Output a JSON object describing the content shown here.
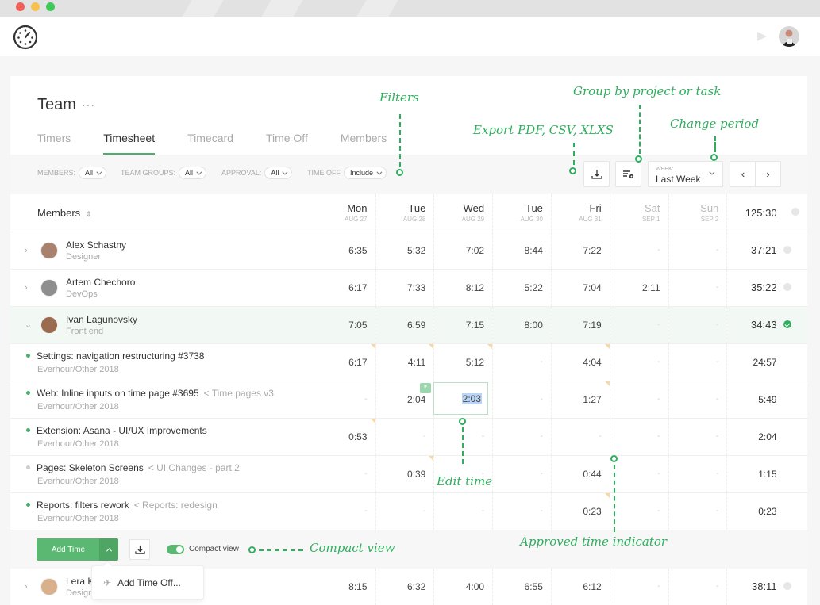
{
  "window": {
    "traffic_lights": {
      "close": "#f25f58",
      "minimize": "#f8c14c",
      "maximize": "#3ec956"
    }
  },
  "appbar": {
    "logo_icon": "stopwatch-dots-icon",
    "notification_icon": "bell-icon",
    "user_avatar": "user-avatar"
  },
  "page": {
    "title": "Team",
    "more_label": "···",
    "tabs": [
      {
        "label": "Timers",
        "active": false
      },
      {
        "label": "Timesheet",
        "active": true
      },
      {
        "label": "Timecard",
        "active": false
      },
      {
        "label": "Time Off",
        "active": false
      },
      {
        "label": "Members",
        "active": false
      }
    ]
  },
  "filters": [
    {
      "label": "MEMBERS:",
      "value": "All"
    },
    {
      "label": "TEAM GROUPS:",
      "value": "All"
    },
    {
      "label": "APPROVAL:",
      "value": "All"
    },
    {
      "label": "TIME OFF",
      "value": "Include"
    }
  ],
  "toolbar": {
    "export_icon": "download-icon",
    "group_icon": "list-settings-icon",
    "week_label": "WEEK:",
    "week_value": "Last Week",
    "prev_icon": "chevron-left-icon",
    "next_icon": "chevron-right-icon"
  },
  "table": {
    "members_header": "Members",
    "sort_icon": "sort-icon",
    "grand_total": "125:30",
    "days": [
      {
        "name": "Mon",
        "date": "AUG 27",
        "weekend": false
      },
      {
        "name": "Tue",
        "date": "AUG 28",
        "weekend": false
      },
      {
        "name": "Wed",
        "date": "AUG 29",
        "weekend": false
      },
      {
        "name": "Tue",
        "date": "AUG 30",
        "weekend": false
      },
      {
        "name": "Fri",
        "date": "AUG 31",
        "weekend": false
      },
      {
        "name": "Sat",
        "date": "SEP 1",
        "weekend": true
      },
      {
        "name": "Sun",
        "date": "SEP 2",
        "weekend": true
      }
    ],
    "members": [
      {
        "name": "Alex Schastny",
        "role": "Designer",
        "times": [
          "6:35",
          "5:32",
          "7:02",
          "8:44",
          "7:22",
          "-",
          "-"
        ],
        "total": "37:21",
        "approved": false,
        "expanded": false
      },
      {
        "name": "Artem Chechoro",
        "role": "DevOps",
        "times": [
          "6:17",
          "7:33",
          "8:12",
          "5:22",
          "7:04",
          "2:11",
          "-"
        ],
        "total": "35:22",
        "approved": false,
        "expanded": false
      },
      {
        "name": "Ivan Lagunovsky",
        "role": "Front end",
        "times": [
          "7:05",
          "6:59",
          "7:15",
          "8:00",
          "7:19",
          "-",
          "-"
        ],
        "total": "34:43",
        "approved": true,
        "expanded": true
      }
    ],
    "tasks": [
      {
        "title": "Settings: navigation restructuring #3738",
        "parent": "",
        "project": "Everhour/Other 2018",
        "active": true,
        "times": [
          "6:17",
          "4:11",
          "5:12",
          "-",
          "4:04",
          "-",
          "-"
        ],
        "total": "24:57"
      },
      {
        "title": "Web: Inline inputs on time page #3695",
        "parent": "< Time pages v3",
        "project": "Everhour/Other 2018",
        "active": true,
        "times": [
          "-",
          "2:04",
          "2:03",
          "-",
          "1:27",
          "-",
          "-"
        ],
        "total": "5:49"
      },
      {
        "title": "Extension: Asana - UI/UX Improvements",
        "parent": "",
        "project": "Everhour/Other 2018",
        "active": true,
        "times": [
          "0:53",
          "-",
          "-",
          "-",
          "-",
          "-",
          "-"
        ],
        "total": "2:04"
      },
      {
        "title": "Pages: Skeleton Screens",
        "parent": "< UI Changes - part 2",
        "project": "Everhour/Other 2018",
        "active": false,
        "times": [
          "-",
          "0:39",
          "-",
          "-",
          "0:44",
          "-",
          "-"
        ],
        "total": "1:15"
      },
      {
        "title": "Reports: filters rework",
        "parent": "< Reports: redesign",
        "project": "Everhour/Other 2018",
        "active": true,
        "times": [
          "-",
          "-",
          "-",
          "-",
          "0:23",
          "-",
          "-"
        ],
        "total": "0:23"
      }
    ],
    "editing_value": "2:03",
    "last_member": {
      "name": "Lera K",
      "role": "Design",
      "times": [
        "8:15",
        "6:32",
        "4:00",
        "6:55",
        "6:12",
        "-",
        "-"
      ],
      "total": "38:11",
      "approved": false
    }
  },
  "bottom": {
    "add_time_label": "Add Time",
    "compact_view_label": "Compact view",
    "compact_view_on": true,
    "dropdown_item": "Add Time Off..."
  },
  "annotations": {
    "filters": "Filters",
    "group": "Group by project or task",
    "export": "Export PDF, CSV, XLXS",
    "period": "Change period",
    "edit_time": "Edit time",
    "compact": "Compact view",
    "approved": "Approved time indicator"
  }
}
